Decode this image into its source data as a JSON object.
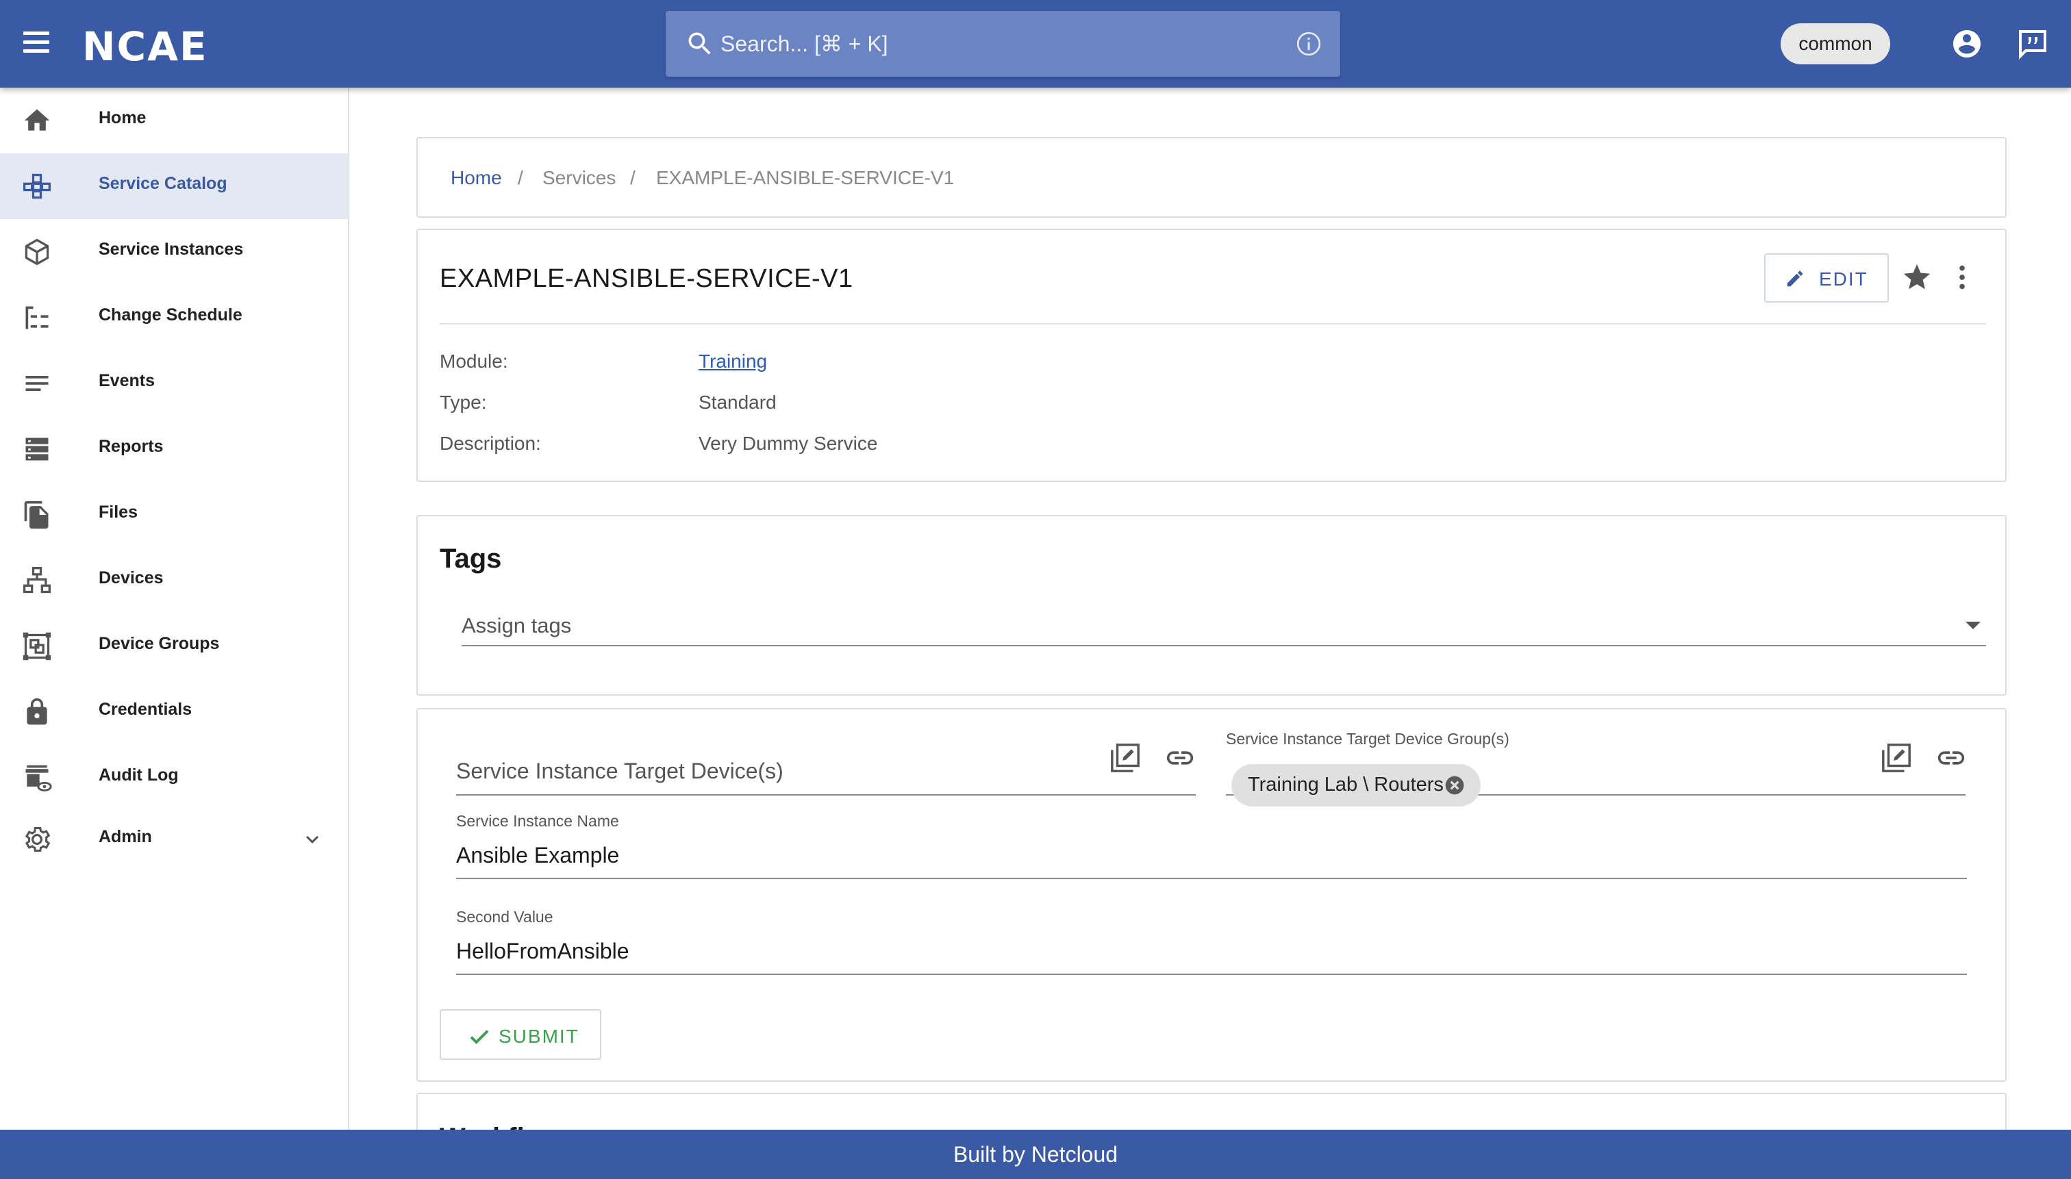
{
  "app": {
    "logo_text": "NCAE",
    "colors": {
      "primary": "#3a5aa6",
      "link": "#2a5bb8",
      "success": "#3aa04a"
    }
  },
  "topbar": {
    "search_placeholder": "Search... [⌘ + K]",
    "tenant_chip": "common",
    "icons": [
      "menu-icon",
      "search-icon",
      "info-icon",
      "account-icon",
      "feedback-icon"
    ]
  },
  "sidebar": {
    "items": [
      {
        "label": "Home",
        "icon": "home-icon"
      },
      {
        "label": "Service Catalog",
        "icon": "catalog-icon",
        "active": true
      },
      {
        "label": "Service Instances",
        "icon": "cube-icon"
      },
      {
        "label": "Change Schedule",
        "icon": "schedule-icon"
      },
      {
        "label": "Events",
        "icon": "lines-icon"
      },
      {
        "label": "Reports",
        "icon": "reports-icon"
      },
      {
        "label": "Files",
        "icon": "files-icon"
      },
      {
        "label": "Devices",
        "icon": "network-icon"
      },
      {
        "label": "Device Groups",
        "icon": "device-groups-icon"
      },
      {
        "label": "Credentials",
        "icon": "lock-icon"
      },
      {
        "label": "Audit Log",
        "icon": "audit-icon"
      },
      {
        "label": "Admin",
        "icon": "gear-icon"
      }
    ]
  },
  "breadcrumb": {
    "items": [
      "Home",
      "Services",
      "EXAMPLE-ANSIBLE-SERVICE-V1"
    ],
    "separator": "/"
  },
  "service": {
    "title": "EXAMPLE-ANSIBLE-SERVICE-V1",
    "edit_label": "EDIT",
    "properties": [
      {
        "label": "Module:",
        "value": "Training"
      },
      {
        "label": "Type:",
        "value": "Standard"
      },
      {
        "label": "Description:",
        "value": "Very Dummy Service"
      }
    ]
  },
  "tags": {
    "title": "Tags",
    "placeholder": "Assign tags"
  },
  "form": {
    "target_devices_placeholder": "Service Instance Target Device(s)",
    "target_groups_label": "Service Instance Target Device Group(s)",
    "target_groups_chip": "Training Lab \\ Routers",
    "name_label": "Service Instance Name",
    "name_value": "Ansible Example",
    "second_label": "Second Value",
    "second_value": "HelloFromAnsible",
    "submit_label": "SUBMIT"
  },
  "workflow": {
    "title": "Workflow"
  },
  "footer": {
    "text": "Built by Netcloud"
  }
}
